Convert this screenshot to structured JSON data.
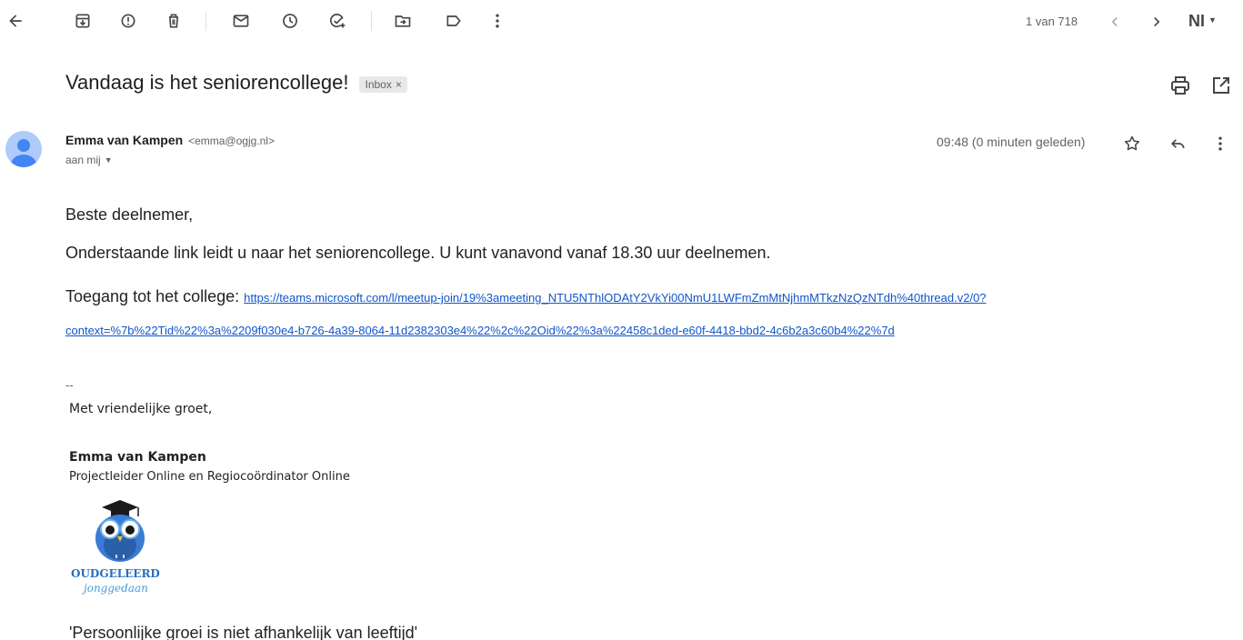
{
  "toolbar": {
    "back_icon": "arrow-left-icon",
    "actions": [
      "archive-icon",
      "report-spam-icon",
      "delete-icon",
      "mark-unread-icon",
      "snooze-icon",
      "add-task-icon",
      "move-to-icon",
      "label-icon",
      "more-vert-icon"
    ],
    "pager": {
      "count": "1 van 718"
    },
    "language": "NI"
  },
  "subject": {
    "title": "Vandaag is het seniorencollege!",
    "label": "Inbox",
    "label_remove": "×"
  },
  "sender": {
    "name": "Emma van Kampen",
    "email": "<emma@ogjg.nl>",
    "to": "aan mij",
    "timestamp": "09:48 (0 minuten geleden)"
  },
  "body": {
    "greeting": "Beste deelnemer,",
    "paragraph": "Onderstaande link leidt u naar het seniorencollege. U kunt vanavond vanaf 18.30 uur deelnemen.",
    "access_label": "Toegang tot het college:",
    "link_line1": "https://teams.microsoft.com/l/meetup-join/19%3ameeting_NTU5NThlODAtY2VkYi00NmU1LWFmZmMtNjhmMTkzNzQzNTdh%40thread.v2/0?",
    "link_line2": "context=%7b%22Tid%22%3a%2209f030e4-b726-4a39-8064-11d2382303e4%22%2c%22Oid%22%3a%22458c1ded-e60f-4418-bbd2-4c6b2a3c60b4%22%7d"
  },
  "signature": {
    "dash": "--",
    "closing": "Met vriendelijke groet,",
    "name": "Emma van Kampen",
    "role": "Projectleider Online en Regiocoördinator Online",
    "logo_text1": "OUDGELEERD",
    "logo_text2": "jonggedaan",
    "quote": "'Persoonlijke groei is niet afhankelijk van leeftijd'"
  },
  "colors": {
    "link": "#1155cc",
    "avatar_bg": "#aecbfa",
    "avatar_fg": "#4285f4",
    "logo_blue": "#2a6cc0"
  }
}
